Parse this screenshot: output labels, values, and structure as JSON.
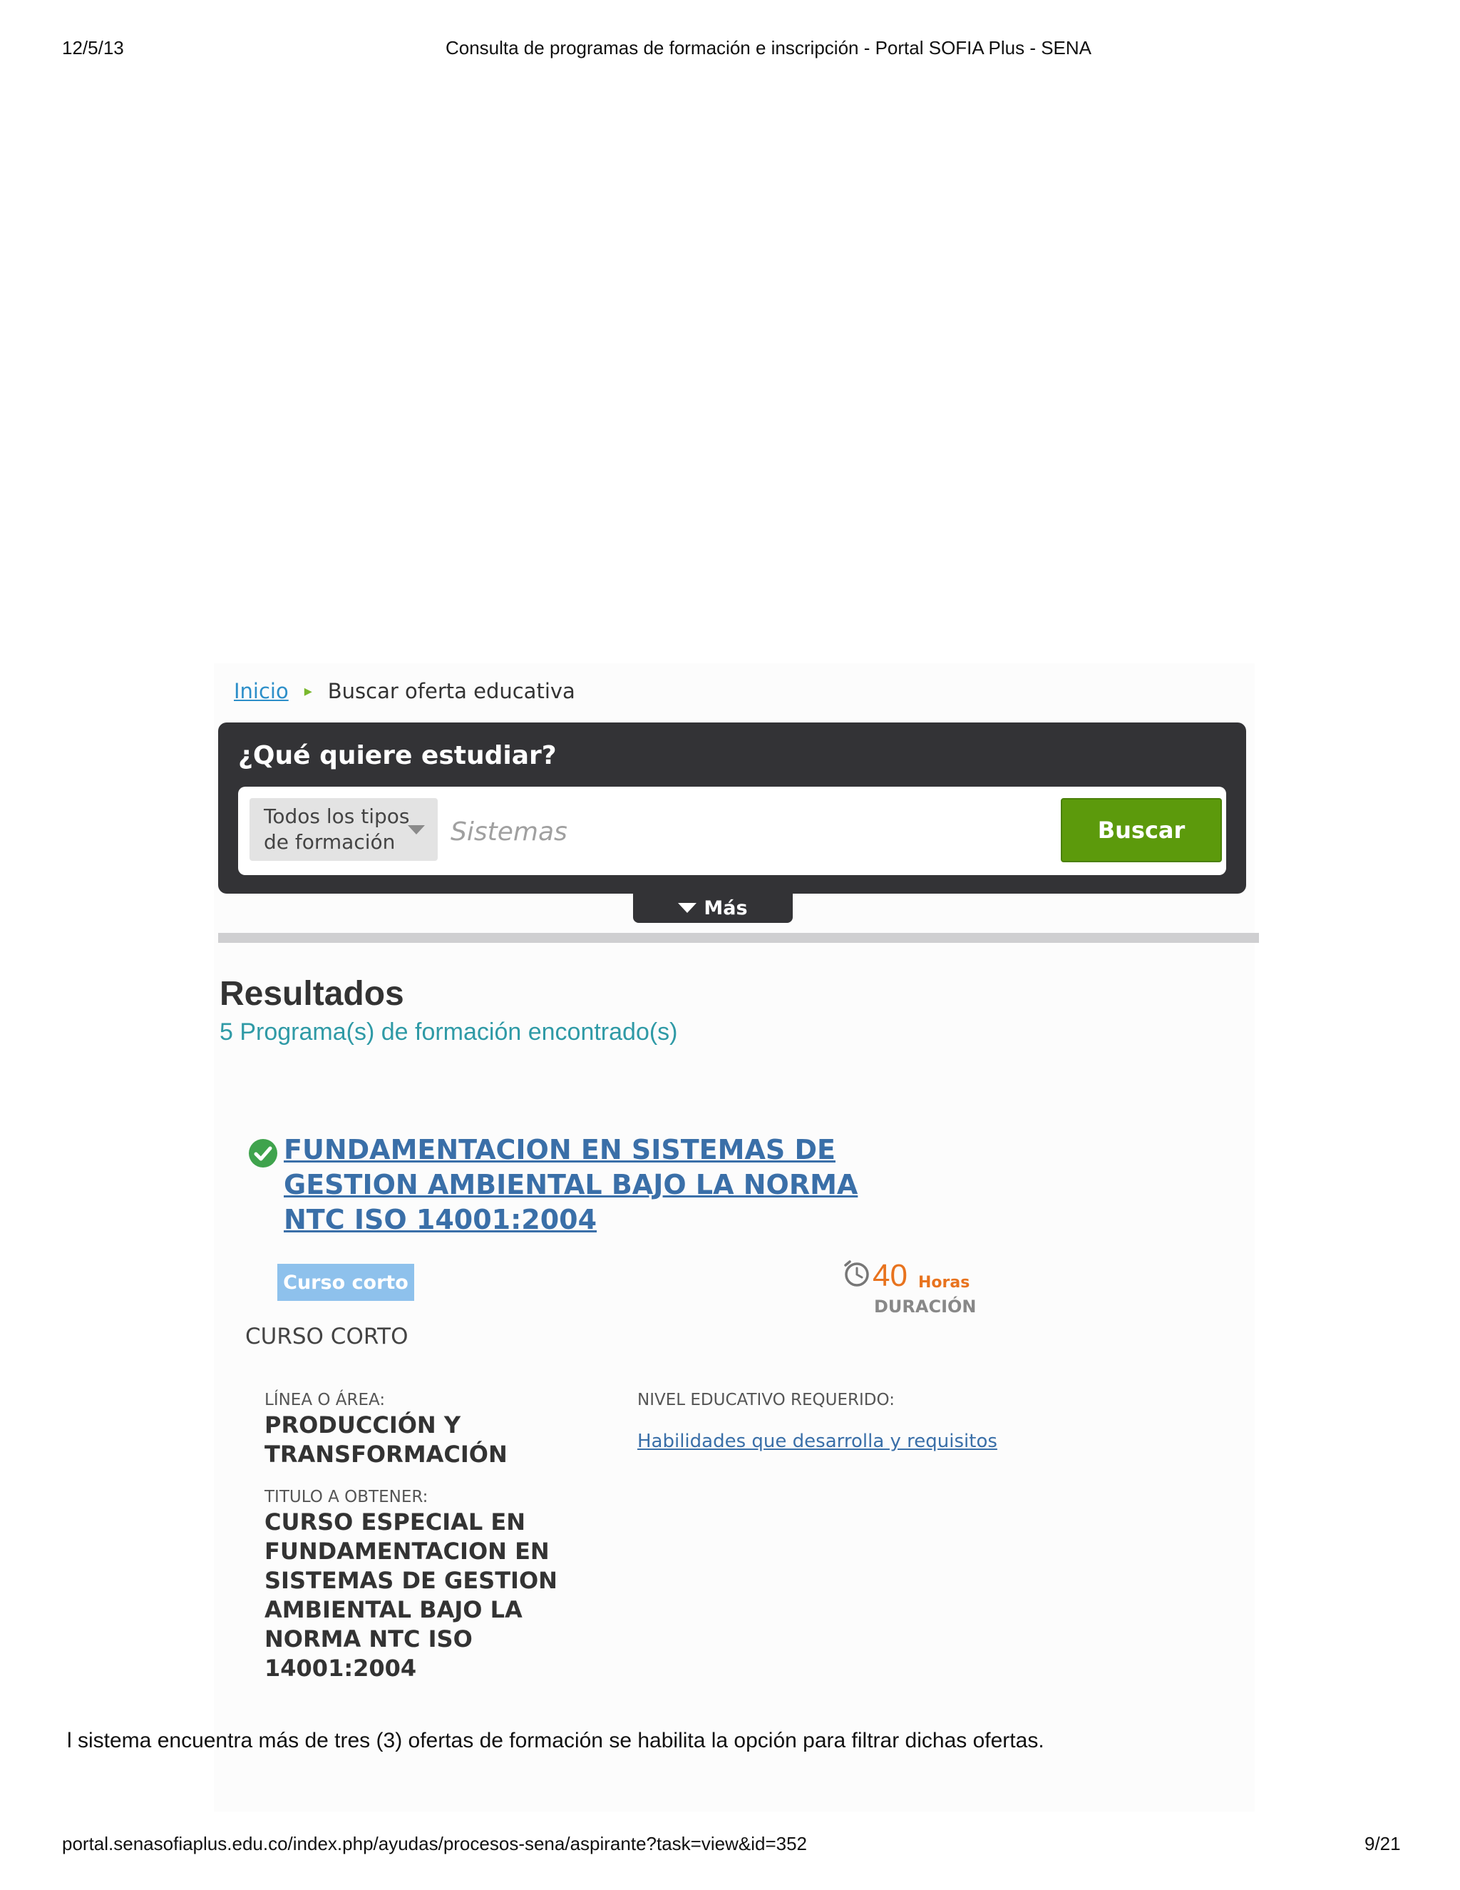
{
  "print": {
    "date": "12/5/13",
    "title": "Consulta de programas de formación e inscripción - Portal SOFIA Plus - SENA",
    "url": "portal.senasofiaplus.edu.co/index.php/ayudas/procesos-sena/aspirante?task=view&id=352",
    "page": "9/21"
  },
  "breadcrumb": {
    "home": "Inicio",
    "current": "Buscar oferta educativa"
  },
  "search": {
    "heading": "¿Qué quiere estudiar?",
    "type_select": "Todos los tipos de formación",
    "query": "Sistemas",
    "button": "Buscar",
    "more": "Más"
  },
  "results": {
    "title": "Resultados",
    "count": "5 Programa(s) de formación encontrado(s)"
  },
  "program": {
    "title": "FUNDAMENTACION EN SISTEMAS DE GESTION AMBIENTAL BAJO LA NORMA NTC ISO 14001:2004",
    "badge": "Curso corto",
    "badge_sub": "CURSO CORTO",
    "duration_value": "40",
    "duration_unit": "Horas",
    "duration_label": "DURACIÓN",
    "area_label": "LÍNEA O ÁREA:",
    "area_value": "PRODUCCIÓN Y TRANSFORMACIÓN",
    "titulo_label": "TITULO A OBTENER:",
    "titulo_value": "CURSO ESPECIAL EN FUNDAMENTACION EN SISTEMAS DE GESTION AMBIENTAL BAJO LA NORMA NTC ISO 14001:2004",
    "nivel_label": "NIVEL EDUCATIVO REQUERIDO:",
    "nivel_link": "Habilidades que desarrolla y requisitos"
  },
  "caption": "l sistema encuentra más de tres (3) ofertas de formación se habilita la opción para filtrar dichas ofertas.",
  "colors": {
    "panel": "#333336",
    "buscar_green": "#5c9a0c",
    "link_blue": "#3a6fa8",
    "count_teal": "#2f9aa6",
    "duration_orange": "#e8731e",
    "badge_blue": "#8ec1ec"
  }
}
